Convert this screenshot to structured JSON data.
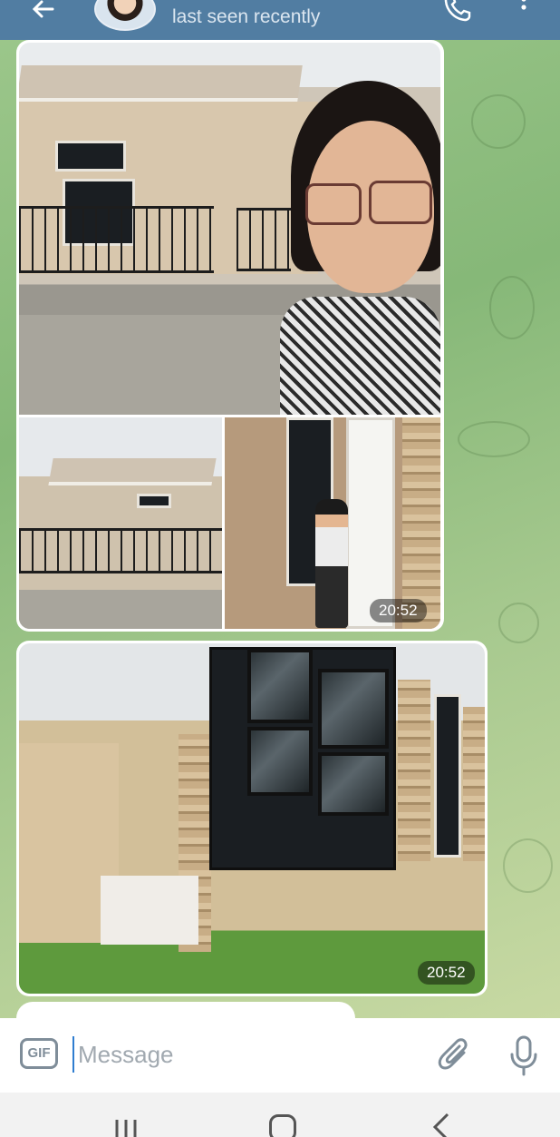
{
  "header": {
    "status": "last seen recently",
    "icons": [
      "back-arrow-icon",
      "avatar",
      "phone-icon",
      "more-vert-icon"
    ]
  },
  "messages": [
    {
      "type": "album",
      "timestamp": "20:52"
    },
    {
      "type": "photo",
      "timestamp": "20:52"
    }
  ],
  "input": {
    "placeholder": "Message",
    "gif_label": "GIF",
    "icons": [
      "attach-icon",
      "mic-icon"
    ]
  },
  "colors": {
    "header": "#517da2",
    "chat_background": "#8fbc7f",
    "accent": "#2f7dd0"
  }
}
